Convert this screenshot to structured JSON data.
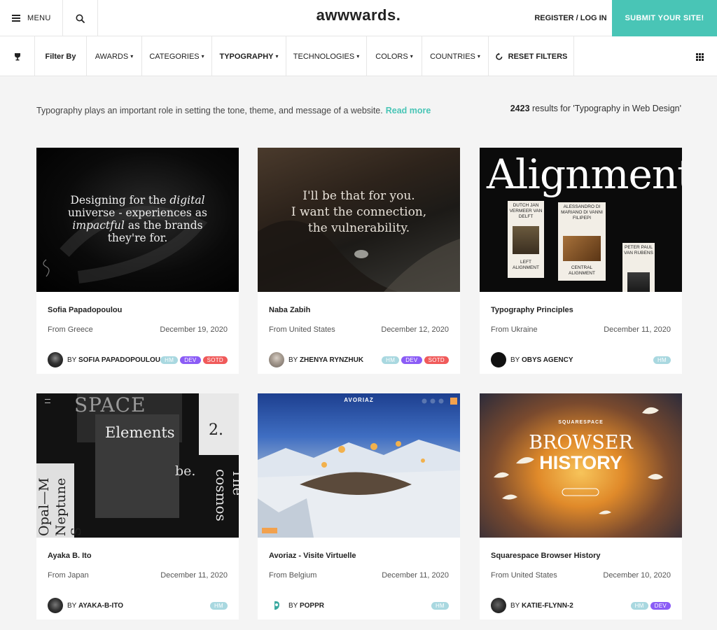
{
  "header": {
    "menu_label": "MENU",
    "logo": "awwwards.",
    "register_label": "REGISTER / LOG IN",
    "submit_label": "SUBMIT YOUR SITE!",
    "accent_color": "#49c5b6"
  },
  "filters": {
    "filter_by": "Filter By",
    "awards": "AWARDS",
    "categories": "CATEGORIES",
    "typography": "TYPOGRAPHY",
    "technologies": "TECHNOLOGIES",
    "colors": "COLORS",
    "countries": "COUNTRIES",
    "reset": "RESET FILTERS",
    "caret": "▾"
  },
  "intro": {
    "text": "Typography plays an important role in setting the tone, theme, and message of a website.",
    "read_more": "Read more",
    "results_count": "2423",
    "results_text": " results for 'Typography in Web Design'"
  },
  "cards": [
    {
      "title": "Sofia Papadopoulou",
      "from": "From Greece",
      "date": "December 19, 2020",
      "by": "BY",
      "author": "SOFIA PAPADOPOULOU",
      "badges": [
        "HM",
        "DEV",
        "SOTD"
      ],
      "thumb": {
        "line1": "Designing for the",
        "italic1": "digital",
        "line2": "universe - experiences as",
        "italic2": "impactful",
        "line3": "as the brands",
        "line4": "they're for."
      }
    },
    {
      "title": "Naba Zabih",
      "from": "From United States",
      "date": "December 12, 2020",
      "by": "BY",
      "author": "ZHENYA RYNZHUK",
      "badges": [
        "HM",
        "DEV",
        "SOTD"
      ],
      "thumb": {
        "line1": "I'll be that for you.",
        "line2": "I want the connection,",
        "line3": "the vulnerability."
      }
    },
    {
      "title": "Typography Principles",
      "from": "From Ukraine",
      "date": "December 11, 2020",
      "by": "BY",
      "author": "OBYS AGENCY",
      "badges": [
        "HM"
      ],
      "thumb": {
        "word": "Alignment",
        "tag1": "DUTCH JAN VERMEER VAN DELFT",
        "tag2": "ALESSANDRO DI MARIANO DI VANNI FILIPEPI",
        "tag3": "PETER PAUL VAN RUBENS",
        "tag4": "LEFT ALIGNMENT",
        "tag5": "CENTRAL ALIGNMENT"
      }
    },
    {
      "title": "Ayaka B. Ito",
      "from": "From Japan",
      "date": "December 11, 2020",
      "by": "BY",
      "author": "AYAKA-B-ITO",
      "badges": [
        "HM"
      ],
      "thumb": {
        "word1": "SPACE",
        "word2": "Elements",
        "word3": "be.",
        "word4": "2.",
        "word5": "The cosmos",
        "word6": "Opal—M",
        "word7": "Neptune S"
      }
    },
    {
      "title": "Avoriaz - Visite Virtuelle",
      "from": "From Belgium",
      "date": "December 11, 2020",
      "by": "BY",
      "author": "POPPR",
      "badges": [
        "HM"
      ],
      "thumb": {
        "brand": "AVORIAZ"
      }
    },
    {
      "title": "Squarespace Browser History",
      "from": "From United States",
      "date": "December 10, 2020",
      "by": "BY",
      "author": "KATIE-FLYNN-2",
      "badges": [
        "HM",
        "DEV"
      ],
      "thumb": {
        "brand": "SQUARESPACE",
        "line1": "BROWSER",
        "line2": "HISTORY"
      }
    }
  ]
}
